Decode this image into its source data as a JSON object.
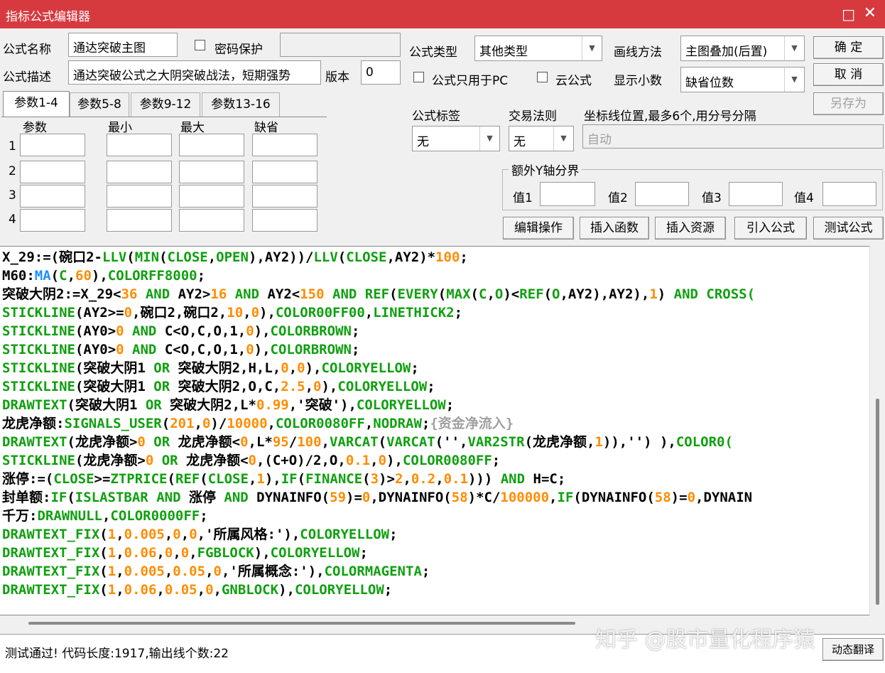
{
  "window": {
    "title": "指标公式编辑器",
    "maximize": "□",
    "close": "✕"
  },
  "form": {
    "name_label": "公式名称",
    "name_value": "通达突破主图",
    "password_label": "密码保护",
    "desc_label": "公式描述",
    "desc_value": "通达突破公式之大阴突破战法，短期强势",
    "version_label": "版本",
    "version_value": "0",
    "type_label": "公式类型",
    "type_value": "其他类型",
    "draw_label": "画线方法",
    "draw_value": "主图叠加(后置)",
    "pc_only_label": "公式只用于PC",
    "cloud_label": "云公式",
    "decimal_label": "显示小数",
    "decimal_value": "缺省位数",
    "tag_label": "公式标签",
    "tag_value": "无",
    "rule_label": "交易法则",
    "rule_value": "无",
    "axis_label": "坐标线位置,最多6个,用分号分隔",
    "axis_value": "自动",
    "yaxis_group": "额外Y轴分界",
    "val1": "值1",
    "val2": "值2",
    "val3": "值3",
    "val4": "值4"
  },
  "buttons": {
    "ok": "确  定",
    "cancel": "取  消",
    "save_as": "另存为",
    "edit_op": "编辑操作",
    "insert_func": "插入函数",
    "insert_res": "插入资源",
    "import": "引入公式",
    "test": "测试公式",
    "translate": "动态翻译"
  },
  "tabs": [
    "参数1-4",
    "参数5-8",
    "参数9-12",
    "参数13-16"
  ],
  "param_headers": [
    "参数",
    "最小",
    "最大",
    "缺省"
  ],
  "param_rows": [
    "1",
    "2",
    "3",
    "4"
  ],
  "code_lines": [
    [
      [
        "X_29:=(碗口2-",
        "k"
      ],
      [
        "LLV",
        "f"
      ],
      [
        "(",
        "k"
      ],
      [
        "MIN",
        "f"
      ],
      [
        "(",
        "k"
      ],
      [
        "CLOSE",
        "f"
      ],
      [
        ",",
        "k"
      ],
      [
        "OPEN",
        "f"
      ],
      [
        "),AY2))/",
        "k"
      ],
      [
        "LLV",
        "f"
      ],
      [
        "(",
        "k"
      ],
      [
        "CLOSE",
        "f"
      ],
      [
        ",AY2)*",
        "k"
      ],
      [
        "100",
        "n"
      ],
      [
        ";",
        "k"
      ]
    ],
    [
      [
        "M60:",
        "k"
      ],
      [
        "MA",
        "b"
      ],
      [
        "(",
        "k"
      ],
      [
        "C",
        "f"
      ],
      [
        ",",
        "k"
      ],
      [
        "60",
        "n"
      ],
      [
        "),",
        "k"
      ],
      [
        "COLORFF8000",
        "f"
      ],
      [
        ";",
        "k"
      ]
    ],
    [
      [
        "突破大阴2:=X_29<",
        "k"
      ],
      [
        "36",
        "n"
      ],
      [
        " AND ",
        "f"
      ],
      [
        "AY2>",
        "k"
      ],
      [
        "16",
        "n"
      ],
      [
        " AND ",
        "f"
      ],
      [
        "AY2<",
        "k"
      ],
      [
        "150",
        "n"
      ],
      [
        " AND ",
        "f"
      ],
      [
        "REF",
        "f"
      ],
      [
        "(",
        "k"
      ],
      [
        "EVERY",
        "f"
      ],
      [
        "(",
        "k"
      ],
      [
        "MAX",
        "f"
      ],
      [
        "(",
        "k"
      ],
      [
        "C",
        "f"
      ],
      [
        ",",
        "k"
      ],
      [
        "O",
        "f"
      ],
      [
        ")<",
        "k"
      ],
      [
        "REF",
        "f"
      ],
      [
        "(",
        "k"
      ],
      [
        "O",
        "f"
      ],
      [
        ",AY2),AY2),",
        "k"
      ],
      [
        "1",
        "n"
      ],
      [
        ") ",
        "k"
      ],
      [
        "AND ",
        "f"
      ],
      [
        "CROSS(",
        "f"
      ]
    ],
    [
      [
        "STICKLINE",
        "f"
      ],
      [
        "(AY2>=",
        "k"
      ],
      [
        "0",
        "n"
      ],
      [
        ",碗口2,碗口2,",
        "k"
      ],
      [
        "10",
        "n"
      ],
      [
        ",",
        "k"
      ],
      [
        "0",
        "n"
      ],
      [
        "),",
        "k"
      ],
      [
        "COLOR00FF00",
        "f"
      ],
      [
        ",",
        "k"
      ],
      [
        "LINETHICK2",
        "f"
      ],
      [
        ";",
        "k"
      ]
    ],
    [
      [
        "STICKLINE",
        "f"
      ],
      [
        "(AY0>",
        "k"
      ],
      [
        "0",
        "n"
      ],
      [
        " AND ",
        "f"
      ],
      [
        "C<O,C,O,1,",
        "k"
      ],
      [
        "0",
        "n"
      ],
      [
        "),",
        "k"
      ],
      [
        "COLORBROWN",
        "f"
      ],
      [
        ";",
        "k"
      ]
    ],
    [
      [
        "STICKLINE",
        "f"
      ],
      [
        "(AY0>",
        "k"
      ],
      [
        "0",
        "n"
      ],
      [
        " AND ",
        "f"
      ],
      [
        "C<O,C,O,1,",
        "k"
      ],
      [
        "0",
        "n"
      ],
      [
        "),",
        "k"
      ],
      [
        "COLORBROWN",
        "f"
      ],
      [
        ";",
        "k"
      ]
    ],
    [
      [
        "STICKLINE",
        "f"
      ],
      [
        "(突破大阴1 ",
        "k"
      ],
      [
        "OR ",
        "f"
      ],
      [
        "突破大阴2,H,L,",
        "k"
      ],
      [
        "0",
        "n"
      ],
      [
        ",",
        "k"
      ],
      [
        "0",
        "n"
      ],
      [
        "),",
        "k"
      ],
      [
        "COLORYELLOW",
        "f"
      ],
      [
        ";",
        "k"
      ]
    ],
    [
      [
        "STICKLINE",
        "f"
      ],
      [
        "(突破大阴1 ",
        "k"
      ],
      [
        "OR ",
        "f"
      ],
      [
        "突破大阴2,O,C,",
        "k"
      ],
      [
        "2.5",
        "n"
      ],
      [
        ",",
        "k"
      ],
      [
        "0",
        "n"
      ],
      [
        "),",
        "k"
      ],
      [
        "COLORYELLOW",
        "f"
      ],
      [
        ";",
        "k"
      ]
    ],
    [
      [
        "DRAWTEXT",
        "f"
      ],
      [
        "(突破大阴1 ",
        "k"
      ],
      [
        "OR ",
        "f"
      ],
      [
        "突破大阴2,L*",
        "k"
      ],
      [
        "0.99",
        "n"
      ],
      [
        ",'突破'),",
        "k"
      ],
      [
        "COLORYELLOW",
        "f"
      ],
      [
        ";",
        "k"
      ]
    ],
    [
      [
        "龙虎净额:",
        "k"
      ],
      [
        "SIGNALS_USER",
        "f"
      ],
      [
        "(",
        "k"
      ],
      [
        "201",
        "n"
      ],
      [
        ",",
        "k"
      ],
      [
        "0",
        "n"
      ],
      [
        ")/",
        "k"
      ],
      [
        "10000",
        "n"
      ],
      [
        ",",
        "k"
      ],
      [
        "COLOR0080FF",
        "f"
      ],
      [
        ",",
        "k"
      ],
      [
        "NODRAW",
        "f"
      ],
      [
        ";",
        "k"
      ],
      [
        "{资金净流入}",
        "g"
      ]
    ],
    [
      [
        "DRAWTEXT",
        "f"
      ],
      [
        "(龙虎净额>",
        "k"
      ],
      [
        "0",
        "n"
      ],
      [
        " OR ",
        "f"
      ],
      [
        "龙虎净额<",
        "k"
      ],
      [
        "0",
        "n"
      ],
      [
        ",L*",
        "k"
      ],
      [
        "95",
        "n"
      ],
      [
        "/",
        "k"
      ],
      [
        "100",
        "n"
      ],
      [
        ",",
        "k"
      ],
      [
        "VARCAT",
        "f"
      ],
      [
        "(",
        "k"
      ],
      [
        "VARCAT",
        "f"
      ],
      [
        "('',",
        "k"
      ],
      [
        "VAR2STR",
        "f"
      ],
      [
        "(龙虎净额,",
        "k"
      ],
      [
        "1",
        "n"
      ],
      [
        ")),'') ),",
        "k"
      ],
      [
        "COLOR0(",
        "f"
      ]
    ],
    [
      [
        "STICKLINE",
        "f"
      ],
      [
        "(龙虎净额>",
        "k"
      ],
      [
        "0",
        "n"
      ],
      [
        " OR ",
        "f"
      ],
      [
        "龙虎净额<",
        "k"
      ],
      [
        "0",
        "n"
      ],
      [
        ",(C+O)/2,O,",
        "k"
      ],
      [
        "0.1",
        "n"
      ],
      [
        ",",
        "k"
      ],
      [
        "0",
        "n"
      ],
      [
        "),",
        "k"
      ],
      [
        "COLOR0080FF",
        "f"
      ],
      [
        ";",
        "k"
      ]
    ],
    [
      [
        "涨停:=(",
        "k"
      ],
      [
        "CLOSE",
        "f"
      ],
      [
        ">=",
        "k"
      ],
      [
        "ZTPRICE",
        "f"
      ],
      [
        "(",
        "k"
      ],
      [
        "REF",
        "f"
      ],
      [
        "(",
        "k"
      ],
      [
        "CLOSE",
        "f"
      ],
      [
        ",",
        "k"
      ],
      [
        "1",
        "n"
      ],
      [
        "),",
        "k"
      ],
      [
        "IF",
        "f"
      ],
      [
        "(",
        "k"
      ],
      [
        "FINANCE",
        "f"
      ],
      [
        "(",
        "k"
      ],
      [
        "3",
        "n"
      ],
      [
        ")>",
        "k"
      ],
      [
        "2",
        "n"
      ],
      [
        ",",
        "k"
      ],
      [
        "0.2",
        "n"
      ],
      [
        ",",
        "k"
      ],
      [
        "0.1",
        "n"
      ],
      [
        "))) ",
        "k"
      ],
      [
        "AND ",
        "f"
      ],
      [
        "H=C;",
        "k"
      ]
    ],
    [
      [
        "封单额:",
        "k"
      ],
      [
        "IF",
        "f"
      ],
      [
        "(",
        "k"
      ],
      [
        "ISLASTBAR",
        "f"
      ],
      [
        " AND ",
        "f"
      ],
      [
        "涨停 ",
        "k"
      ],
      [
        "AND ",
        "f"
      ],
      [
        "DYNAINFO(",
        "k"
      ],
      [
        "59",
        "n"
      ],
      [
        ")=",
        "k"
      ],
      [
        "0",
        "n"
      ],
      [
        ",DYNAINFO(",
        "k"
      ],
      [
        "58",
        "n"
      ],
      [
        ")*C/",
        "k"
      ],
      [
        "100000",
        "n"
      ],
      [
        ",",
        "k"
      ],
      [
        "IF",
        "f"
      ],
      [
        "(DYNAINFO(",
        "k"
      ],
      [
        "58",
        "n"
      ],
      [
        ")=",
        "k"
      ],
      [
        "0",
        "n"
      ],
      [
        ",DYNAIN",
        "k"
      ]
    ],
    [
      [
        "千万:",
        "k"
      ],
      [
        "DRAWNULL",
        "f"
      ],
      [
        ",",
        "k"
      ],
      [
        "COLOR0000FF",
        "f"
      ],
      [
        ";",
        "k"
      ]
    ],
    [
      [
        "DRAWTEXT_FIX",
        "f"
      ],
      [
        "(",
        "k"
      ],
      [
        "1",
        "n"
      ],
      [
        ",",
        "k"
      ],
      [
        "0.005",
        "n"
      ],
      [
        ",",
        "k"
      ],
      [
        "0",
        "n"
      ],
      [
        ",",
        "k"
      ],
      [
        "0",
        "n"
      ],
      [
        ",'所属风格:'),",
        "k"
      ],
      [
        "COLORYELLOW",
        "f"
      ],
      [
        ";",
        "k"
      ]
    ],
    [
      [
        "DRAWTEXT_FIX",
        "f"
      ],
      [
        "(",
        "k"
      ],
      [
        "1",
        "n"
      ],
      [
        ",",
        "k"
      ],
      [
        "0.06",
        "n"
      ],
      [
        ",",
        "k"
      ],
      [
        "0",
        "n"
      ],
      [
        ",",
        "k"
      ],
      [
        "0",
        "n"
      ],
      [
        ",",
        "k"
      ],
      [
        "FGBLOCK",
        "f"
      ],
      [
        "),",
        "k"
      ],
      [
        "COLORYELLOW",
        "f"
      ],
      [
        ";",
        "k"
      ]
    ],
    [
      [
        "DRAWTEXT_FIX",
        "f"
      ],
      [
        "(",
        "k"
      ],
      [
        "1",
        "n"
      ],
      [
        ",",
        "k"
      ],
      [
        "0.005",
        "n"
      ],
      [
        ",",
        "k"
      ],
      [
        "0.05",
        "n"
      ],
      [
        ",",
        "k"
      ],
      [
        "0",
        "n"
      ],
      [
        ",'所属概念:'),",
        "k"
      ],
      [
        "COLORMAGENTA",
        "f"
      ],
      [
        ";",
        "k"
      ]
    ],
    [
      [
        "DRAWTEXT_FIX",
        "f"
      ],
      [
        "(",
        "k"
      ],
      [
        "1",
        "n"
      ],
      [
        ",",
        "k"
      ],
      [
        "0.06",
        "n"
      ],
      [
        ",",
        "k"
      ],
      [
        "0.05",
        "n"
      ],
      [
        ",",
        "k"
      ],
      [
        "0",
        "n"
      ],
      [
        ",",
        "k"
      ],
      [
        "GNBLOCK",
        "f"
      ],
      [
        "),",
        "k"
      ],
      [
        "COLORYELLOW",
        "f"
      ],
      [
        ";",
        "k"
      ]
    ]
  ],
  "status": {
    "message": "测试通过! 代码长度:1917,输出线个数:22"
  },
  "watermark": "知乎 @股市量化程序猿"
}
